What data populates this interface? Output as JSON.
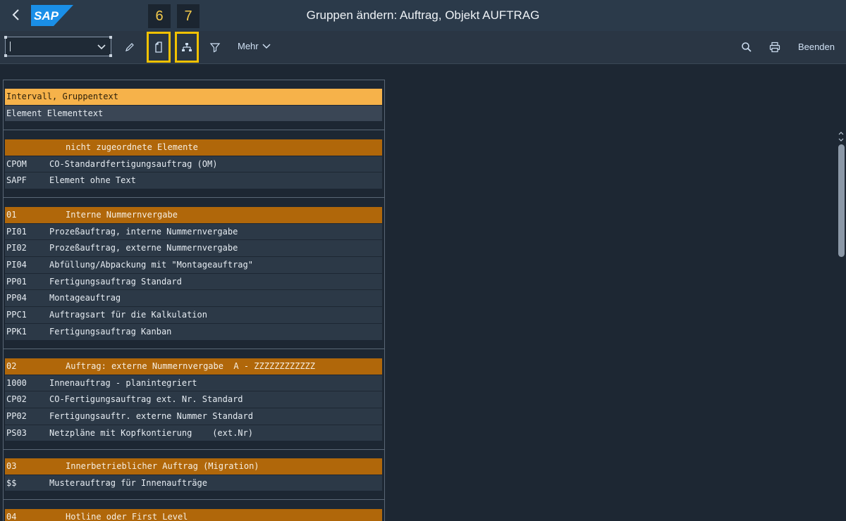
{
  "shell": {
    "title": "Gruppen ändern: Auftrag, Objekt AUFTRAG",
    "logo_text": "SAP"
  },
  "callouts": [
    "6",
    "7"
  ],
  "toolbar": {
    "dropdown_value": "",
    "more_label": "Mehr",
    "exit_label": "Beenden",
    "icons": [
      "pencil-icon",
      "document-icon",
      "hierarchy-icon",
      "filter-icon",
      "search-icon",
      "print-icon"
    ]
  },
  "legend": {
    "header": "Intervall, Gruppentext",
    "sub": "Element Elementtext"
  },
  "groups": [
    {
      "code": "",
      "title": "nicht zugeordnete Elemente",
      "items": [
        {
          "code": "CPOM",
          "text": "CO-Standardfertigungsauftrag (OM)"
        },
        {
          "code": "SAPF",
          "text": "Element ohne Text"
        }
      ]
    },
    {
      "code": "01",
      "title": "Interne Nummernvergabe",
      "items": [
        {
          "code": "PI01",
          "text": "Prozeßauftrag, interne Nummernvergabe"
        },
        {
          "code": "PI02",
          "text": "Prozeßauftrag, externe Nummernvergabe"
        },
        {
          "code": "PI04",
          "text": "Abfüllung/Abpackung mit \"Montageauftrag\""
        },
        {
          "code": "PP01",
          "text": "Fertigungsauftrag Standard"
        },
        {
          "code": "PP04",
          "text": "Montageauftrag"
        },
        {
          "code": "PPC1",
          "text": "Auftragsart für die Kalkulation"
        },
        {
          "code": "PPK1",
          "text": "Fertigungsauftrag Kanban"
        }
      ]
    },
    {
      "code": "02",
      "title": "Auftrag: externe Nummernvergabe  A - ZZZZZZZZZZZZ",
      "items": [
        {
          "code": "1000",
          "text": "Innenauftrag - planintegriert"
        },
        {
          "code": "CP02",
          "text": "CO-Fertigungsauftrag ext. Nr. Standard"
        },
        {
          "code": "PP02",
          "text": "Fertigungsauftr. externe Nummer Standard"
        },
        {
          "code": "PS03",
          "text": "Netzpläne mit Kopfkontierung    (ext.Nr)"
        }
      ]
    },
    {
      "code": "03",
      "title": "Innerbetrieblicher Auftrag (Migration)",
      "items": [
        {
          "code": "$$",
          "text": "Musterauftrag für Innenaufträge"
        }
      ]
    },
    {
      "code": "04",
      "title": "Hotline oder First Level",
      "items": []
    }
  ]
}
